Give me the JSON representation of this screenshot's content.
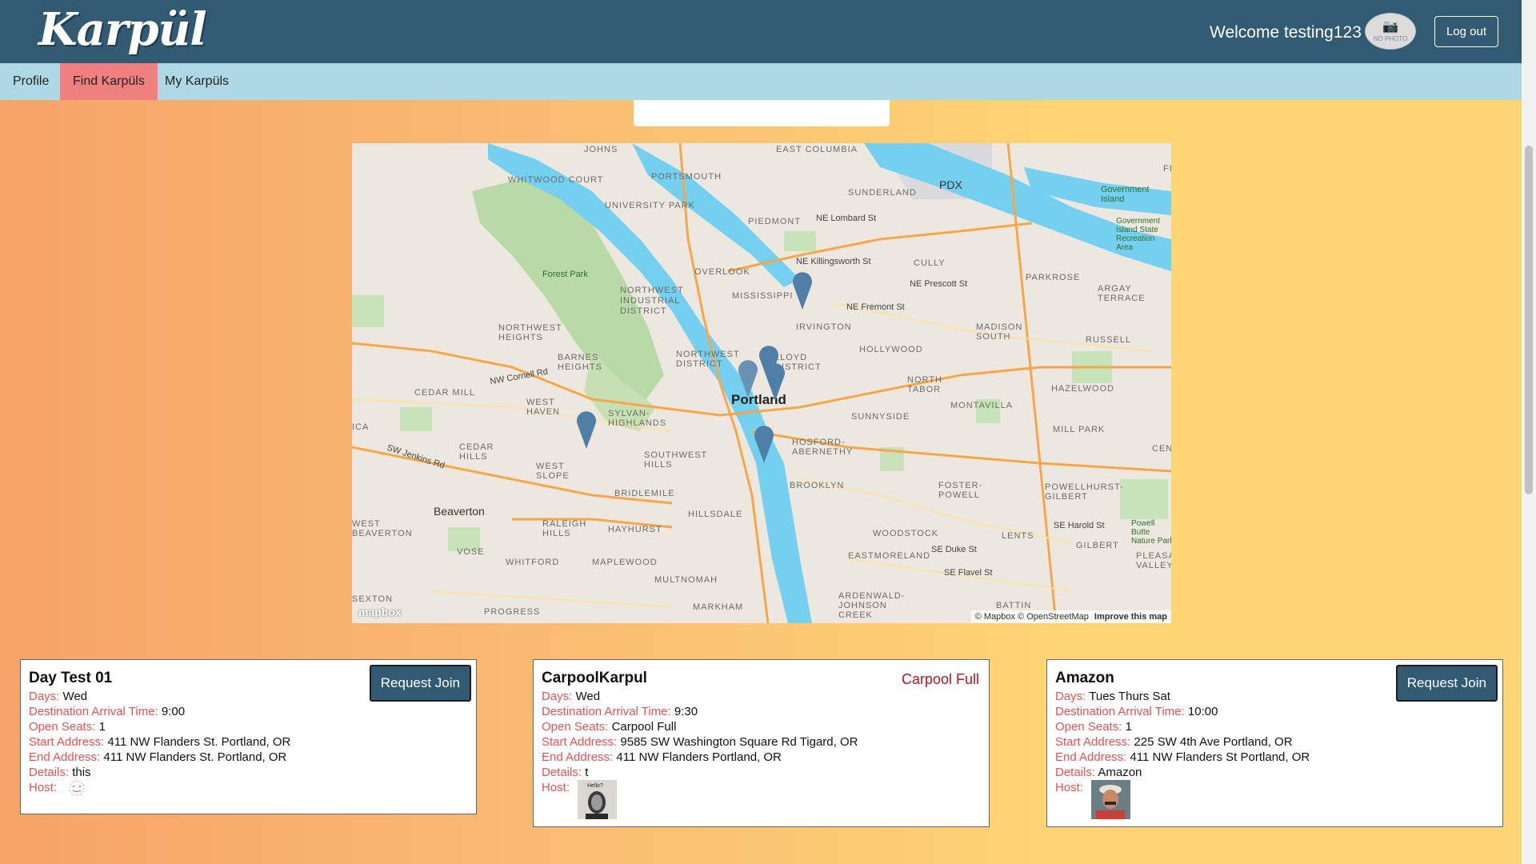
{
  "header": {
    "logo": "Karpül",
    "welcome": "Welcome testing123",
    "avatar_text": "NO PHOTO",
    "logout_label": "Log out"
  },
  "nav": {
    "items": [
      {
        "label": "Profile"
      },
      {
        "label": "Find Karpüls"
      },
      {
        "label": "My Karpüls"
      }
    ],
    "active": "Find Karpüls"
  },
  "map": {
    "labels": {
      "portland": "Portland",
      "beaverton": "Beaverton",
      "forest_park": "Forest Park",
      "pdx": "PDX",
      "government_island": "Government Island",
      "govt_island_park": "Government Island State Recreation Area",
      "powell_butte": "Powell Butte Nature Park",
      "johns": "JOHNS",
      "portsmouth": "PORTSMOUTH",
      "east_columbia": "EAST COLUMBIA",
      "sunderland": "SUNDERLAND",
      "whitwood_court": "WHITWOOD COURT",
      "university_park": "UNIVERSITY PARK",
      "piedmont": "PIEDMONT",
      "ne_lombard": "NE Lombard St",
      "ne_killingsworth": "NE Killingsworth St",
      "cully": "CULLY",
      "ne_prescott": "NE Prescott St",
      "parkrose": "PARKROSE",
      "argay_terrace": "ARGAY TERRACE",
      "overlook": "OVERLOOK",
      "mississippi": "MISSISSIPPI",
      "nw_industrial": "NORTHWEST INDUSTRIAL DISTRICT",
      "ne_fremont": "NE Fremont St",
      "irvington": "IRVINGTON",
      "madison_south": "MADISON SOUTH",
      "russell": "RUSSELL",
      "northwest_heights": "NORTHWEST HEIGHTS",
      "barnes_heights": "BARNES HEIGHTS",
      "northwest_district": "NORTHWEST DISTRICT",
      "lloyd_district": "LLOYD DISTRICT",
      "hollywood": "HOLLYWOOD",
      "north_tabor": "NORTH TABOR",
      "hazelwood": "HAZELWOOD",
      "nw_cornell": "NW Cornell Rd",
      "cedar_mill": "CEDAR MILL",
      "west_haven": "WEST HAVEN",
      "sylvan_highlands": "SYLVAN-HIGHLANDS",
      "montavilla": "MONTAVILLA",
      "sunnyside": "SUNNYSIDE",
      "mill_park": "MILL PARK",
      "sw_jenkins": "SW Jenkins Rd",
      "cedar_hills": "CEDAR HILLS",
      "west_slope": "WEST SLOPE",
      "southwest_hills": "SOUTHWEST HILLS",
      "hosford": "HOSFORD-ABERNETHY",
      "centennial": "CENTE",
      "bridlemile": "BRIDLEMILE",
      "brooklyn": "BROOKLYN",
      "foster_powell": "FOSTER-POWELL",
      "powellhurst": "POWELLHURST-GILBERT",
      "raleigh_hills": "RALEIGH HILLS",
      "hayhurst": "HAYHURST",
      "hillsdale": "HILLSDALE",
      "woodstock": "WOODSTOCK",
      "lents": "LENTS",
      "se_harold": "SE Harold St",
      "gilbert": "GILBERT",
      "west_beaverton": "WEST BEAVERTON",
      "vose": "VOSE",
      "whitford": "WHITFORD",
      "maplewood": "MAPLEWOOD",
      "se_duke": "SE Duke St",
      "pleasant_valley": "PLEASAN VALLEY",
      "eastmoreland": "EASTMORELAND",
      "se_flavel": "SE Flavel St",
      "multnomah": "MULTNOMAH",
      "markham": "MARKHAM",
      "ardenwald": "ARDENWALD- JOHNSON CREEK",
      "progress": "PROGRESS",
      "sexton": "SEXTON",
      "battin": "BATTIN",
      "ica": "ICA",
      "fishe": "FISHE"
    },
    "credit": "© Mapbox © OpenStreetMap",
    "improve": "Improve this map",
    "mapbox": "mapbox"
  },
  "cards": [
    {
      "title": "Day Test 01",
      "days": "Wed",
      "arrival": "9:00",
      "seats": "1",
      "start": "411 NW Flanders St. Portland, OR",
      "end": "411 NW Flanders St. Portland, OR",
      "details": "this",
      "action": "Request Join"
    },
    {
      "title": "CarpoolKarpul",
      "days": "Wed",
      "arrival": "9:30",
      "seats": "Carpool Full",
      "start": "9585 SW Washington Square Rd Tigard, OR",
      "end": "411 NW Flanders Portland, OR",
      "details": "t",
      "status": "Carpool Full"
    },
    {
      "title": "Amazon",
      "days": "Tues Thurs Sat",
      "arrival": "10:00",
      "seats": "1",
      "start": "225 SW 4th Ave Portland, OR",
      "end": "411 NW Flanders St Portland, OR",
      "details": "Amazon",
      "action": "Request Join"
    }
  ],
  "card_labels": {
    "days": "Days:",
    "arrival": "Destination Arrival Time:",
    "seats": "Open Seats:",
    "start": "Start Address:",
    "end": "End Address:",
    "details": "Details:",
    "host": "Host:"
  },
  "host_photo_caption": "Hello?",
  "colors": {
    "header_bg": "#335a73",
    "nav_bg": "#add8e4",
    "nav_active": "#f08080",
    "label_red": "#e8524f",
    "full_red": "#c0141c",
    "river": "#75cfee",
    "marker": "#4f7fa6"
  }
}
